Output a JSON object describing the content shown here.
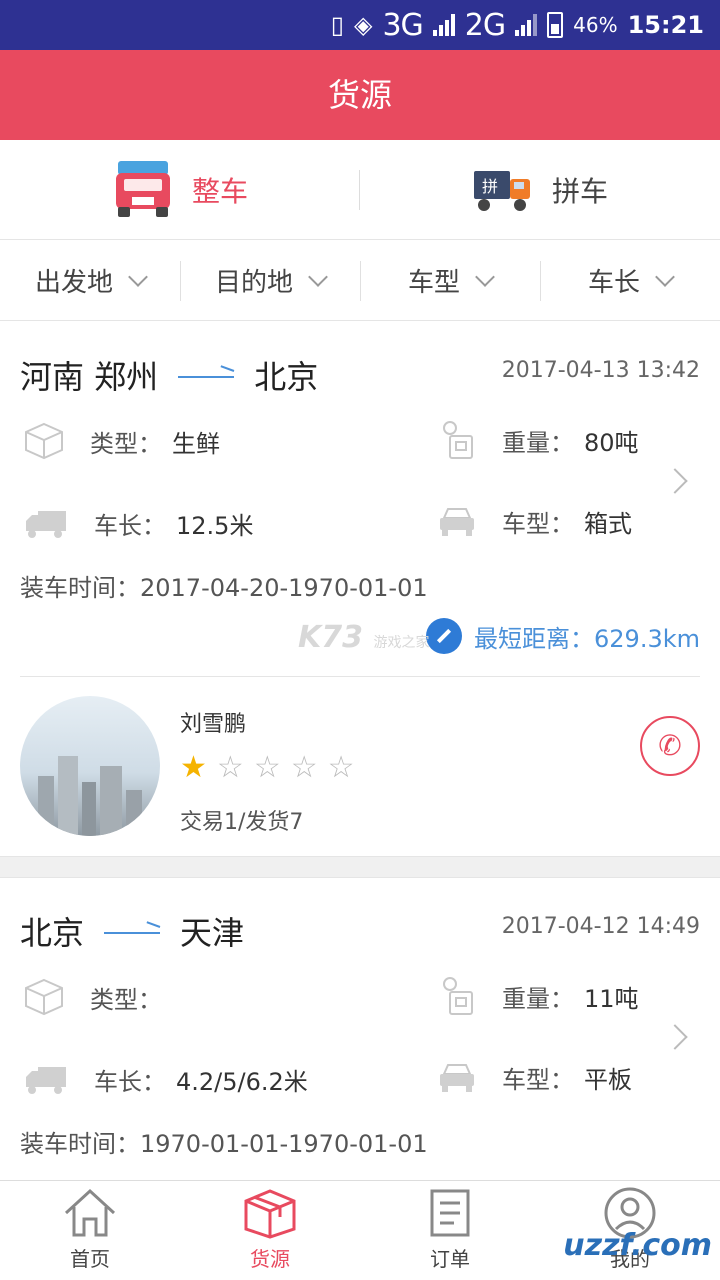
{
  "status_bar": {
    "network_3g": "3G",
    "network_2g": "2G",
    "battery": "46%",
    "time": "15:21"
  },
  "header": {
    "title": "货源"
  },
  "type_tabs": [
    {
      "label": "整车",
      "icon": "red-truck-icon",
      "active": true
    },
    {
      "label": "拼车",
      "icon": "carpool-truck-icon",
      "active": false
    }
  ],
  "filters": [
    {
      "label": "出发地"
    },
    {
      "label": "目的地"
    },
    {
      "label": "车型"
    },
    {
      "label": "车长"
    }
  ],
  "listings": [
    {
      "origin": "河南 郑州",
      "destination": "北京",
      "datetime": "2017-04-13 13:42",
      "type_label": "类型：",
      "type_value": "生鲜",
      "weight_label": "重量：",
      "weight_value": "80吨",
      "length_label": "车长：",
      "length_value": "12.5米",
      "model_label": "车型：",
      "model_value": "箱式",
      "load_time_label": "装车时间：",
      "load_time_value": "2017-04-20-1970-01-01",
      "distance_label": "最短距离：",
      "distance_value": "629.3km",
      "shipper": {
        "name": "刘雪鹏",
        "rating": 1,
        "rating_max": 5,
        "trade_stats": "交易1/发货7"
      }
    },
    {
      "origin": "北京",
      "destination": "天津",
      "datetime": "2017-04-12 14:49",
      "type_label": "类型：",
      "type_value": "",
      "weight_label": "重量：",
      "weight_value": "11吨",
      "length_label": "车长：",
      "length_value": "4.2/5/6.2米",
      "model_label": "车型：",
      "model_value": "平板",
      "load_time_label": "装车时间：",
      "load_time_value": "1970-01-01-1970-01-01"
    }
  ],
  "bottom_nav": [
    {
      "label": "首页",
      "icon": "home-icon",
      "active": false
    },
    {
      "label": "货源",
      "icon": "box-icon",
      "active": true
    },
    {
      "label": "订单",
      "icon": "order-icon",
      "active": false
    },
    {
      "label": "我的",
      "icon": "profile-icon",
      "active": false
    }
  ],
  "watermarks": {
    "k73": "K73",
    "k73_sub": "游戏之家",
    "uzzf": "uzzf.com"
  },
  "colors": {
    "accent": "#e84a5f",
    "status_bar": "#2e3192",
    "link_blue": "#4a90d9"
  }
}
